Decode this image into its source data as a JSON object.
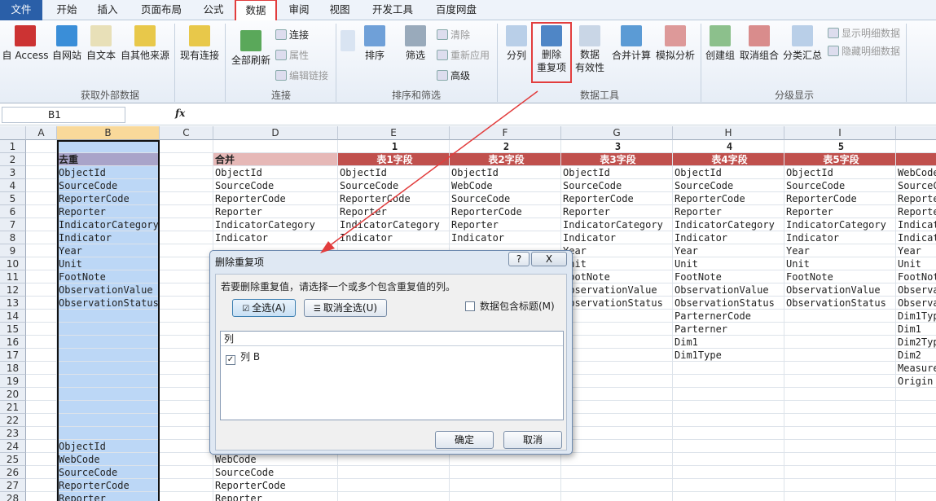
{
  "tabs": [
    "文件",
    "开始",
    "插入",
    "页面布局",
    "公式",
    "数据",
    "审阅",
    "视图",
    "开发工具",
    "百度网盘"
  ],
  "ribbon": {
    "groups": [
      "获取外部数据",
      "连接",
      "排序和筛选",
      "数据工具",
      "分级显示"
    ],
    "ext": [
      "自 Access",
      "自网站",
      "自文本",
      "自其他来源",
      "现有连接"
    ],
    "conn": {
      "refresh": "全部刷新",
      "links": "连接",
      "props": "属性",
      "edit": "编辑链接"
    },
    "sort": {
      "sort": "排序",
      "filter": "筛选",
      "clear": "清除",
      "reapply": "重新应用",
      "adv": "高级"
    },
    "tools": {
      "split": "分列",
      "remove1": "删除",
      "remove2": "重复项",
      "valid1": "数据",
      "valid2": "有效性",
      "merge": "合并计算",
      "whatif": "模拟分析"
    },
    "outline": {
      "group": "创建组",
      "ungroup": "取消组合",
      "subtotal": "分类汇总",
      "show": "显示明细数据",
      "hide": "隐藏明细数据"
    }
  },
  "namebox": "B1",
  "fx": "fx",
  "cols": [
    "A",
    "B",
    "C",
    "D",
    "E",
    "F",
    "G",
    "H",
    "I"
  ],
  "rows": [
    "1",
    "2",
    "3",
    "4",
    "5",
    "6",
    "7",
    "8",
    "9",
    "10",
    "11",
    "12",
    "13",
    "14",
    "15",
    "16",
    "17",
    "18",
    "19",
    "20",
    "21",
    "22",
    "23",
    "24",
    "25",
    "26",
    "27",
    "28"
  ],
  "sheet": {
    "r1": [
      "1",
      "2",
      "3",
      "4",
      "5"
    ],
    "headers": {
      "B": "去重",
      "D": "合并",
      "E": "表1字段",
      "F": "表2字段",
      "G": "表3字段",
      "H": "表4字段",
      "I": "表5字段"
    },
    "B": [
      "ObjectId",
      "SourceCode",
      "ReporterCode",
      "Reporter",
      "IndicatorCategory",
      "Indicator",
      "Year",
      "Unit",
      "FootNote",
      "ObservationValue",
      "ObservationStatus"
    ],
    "B2": [
      "ObjectId",
      "WebCode",
      "SourceCode",
      "ReporterCode",
      "Reporter"
    ],
    "D": [
      "ObjectId",
      "SourceCode",
      "ReporterCode",
      "Reporter",
      "IndicatorCategory",
      "Indicator"
    ],
    "D2": [
      "WebCode",
      "SourceCode",
      "ReporterCode",
      "Reporter"
    ],
    "E": [
      "ObjectId",
      "SourceCode",
      "ReporterCode",
      "Reporter",
      "IndicatorCategory",
      "Indicator"
    ],
    "F": [
      "ObjectId",
      "WebCode",
      "SourceCode",
      "ReporterCode",
      "Reporter",
      "Indicator"
    ],
    "G": [
      "ObjectId",
      "SourceCode",
      "ReporterCode",
      "Reporter",
      "IndicatorCategory",
      "Indicator",
      "Year",
      "Unit",
      "FootNote",
      "ObservationValue",
      "ObservationStatus"
    ],
    "H": [
      "ObjectId",
      "SourceCode",
      "ReporterCode",
      "Reporter",
      "IndicatorCategory",
      "Indicator",
      "Year",
      "Unit",
      "FootNote",
      "ObservationValue",
      "ObservationStatus",
      "ParternerCode",
      "Parterner",
      "Dim1",
      "Dim1Type"
    ],
    "I": [
      "ObjectId",
      "SourceCode",
      "ReporterCode",
      "Reporter",
      "IndicatorCategory",
      "Indicator",
      "Year",
      "Unit",
      "FootNote",
      "ObservationValue",
      "ObservationStatus"
    ],
    "J": [
      "WebCode",
      "SourceC",
      "Reporte",
      "Reporte",
      "Indicat",
      "Indicat",
      "Year",
      "Unit",
      "FootNot",
      "Observa",
      "Observa",
      "Dim1Typ",
      "Dim1",
      "Dim2Typ",
      "Dim2",
      "Measure",
      "Origin"
    ]
  },
  "dialog": {
    "title": "删除重复项",
    "help": "?",
    "close": "X",
    "instruction": "若要删除重复值，请选择一个或多个包含重复值的列。",
    "select_all": "全选(A)",
    "unselect_all": "取消全选(U)",
    "has_headers": "数据包含标题(M)",
    "list_header": "列",
    "item": "列 B",
    "ok": "确定",
    "cancel": "取消"
  },
  "colors": {
    "accent": "#e23d3d",
    "header_red": "#c0504d",
    "select_blue": "#bcd7f6"
  }
}
